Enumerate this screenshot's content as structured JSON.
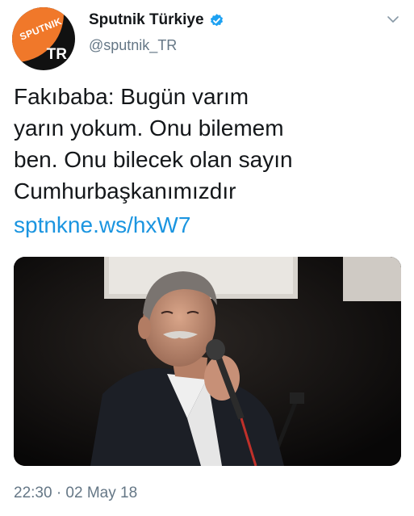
{
  "account": {
    "display_name": "Sputnik Türkiye",
    "handle": "@sputnik_TR",
    "verified": true,
    "avatar_brand": "SPUTNIK",
    "avatar_region": "TR"
  },
  "tweet": {
    "text": "Fakıbaba: Bugün varım\nyarın yokum. Onu bilemem\nben. Onu bilecek olan sayın\nCumhurbaşkanımızdır",
    "link": "sptnkne.ws/hxW7",
    "timestamp": "22:30 · 02 May 18"
  },
  "icons": {
    "verified": "verified-badge-icon",
    "menu": "chevron-down-icon"
  },
  "colors": {
    "link": "#1b95e0",
    "verified": "#1da1f2",
    "avatar_accent": "#f0782a",
    "secondary_text": "#657786"
  }
}
